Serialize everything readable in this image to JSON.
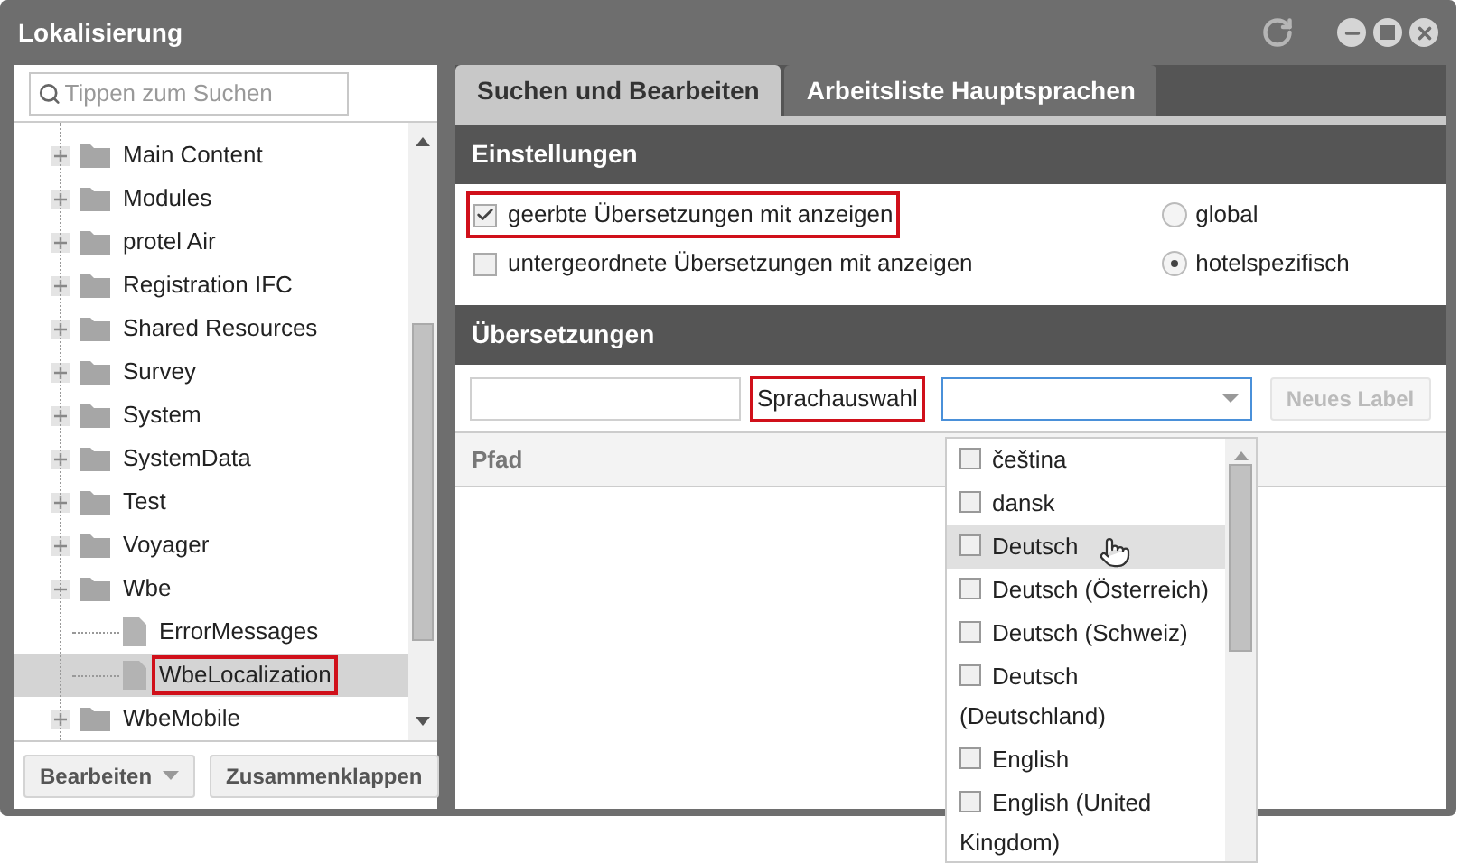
{
  "window": {
    "title": "Lokalisierung"
  },
  "sidebar": {
    "search": {
      "placeholder": "Tippen zum Suchen"
    },
    "tree": [
      {
        "label": "Main Content",
        "kind": "folder",
        "expanded": false
      },
      {
        "label": "Modules",
        "kind": "folder",
        "expanded": false
      },
      {
        "label": "protel Air",
        "kind": "folder",
        "expanded": false
      },
      {
        "label": "Registration IFC",
        "kind": "folder",
        "expanded": false
      },
      {
        "label": "Shared Resources",
        "kind": "folder",
        "expanded": false
      },
      {
        "label": "Survey",
        "kind": "folder",
        "expanded": false
      },
      {
        "label": "System",
        "kind": "folder",
        "expanded": false
      },
      {
        "label": "SystemData",
        "kind": "folder",
        "expanded": false
      },
      {
        "label": "Test",
        "kind": "folder",
        "expanded": false
      },
      {
        "label": "Voyager",
        "kind": "folder",
        "expanded": false
      },
      {
        "label": "Wbe",
        "kind": "folder",
        "expanded": true,
        "children": [
          {
            "label": "ErrorMessages",
            "kind": "file",
            "selected": false,
            "highlighted": false
          },
          {
            "label": "WbeLocalization",
            "kind": "file",
            "selected": true,
            "highlighted": true
          }
        ]
      },
      {
        "label": "WbeMobile",
        "kind": "folder",
        "expanded": false
      }
    ],
    "buttons": [
      {
        "label": "Bearbeiten",
        "dropdown": true
      },
      {
        "label": "Zusammenklappen",
        "dropdown": false
      }
    ]
  },
  "tabs": [
    {
      "label": "Suchen und Bearbeiten",
      "selected": true
    },
    {
      "label": "Arbeitsliste Hauptsprachen",
      "selected": false
    }
  ],
  "settings": {
    "title": "Einstellungen",
    "checkboxes": [
      {
        "label": "geerbte Übersetzungen mit anzeigen",
        "checked": true,
        "highlighted": true
      },
      {
        "label": "untergeordnete Übersetzungen mit anzeigen",
        "checked": false,
        "highlighted": false
      }
    ],
    "radios": [
      {
        "label": "global",
        "selected": false
      },
      {
        "label": "hotelspezifisch",
        "selected": true
      }
    ]
  },
  "translations": {
    "title": "Übersetzungen",
    "language_label": {
      "text": "Sprachauswahl",
      "highlighted": true
    },
    "new_label_button": {
      "label": "Neues Label",
      "disabled": true
    },
    "column": "Pfad",
    "language_options": [
      {
        "label": "čeština",
        "checked": false,
        "hovered": false
      },
      {
        "label": "dansk",
        "checked": false,
        "hovered": false
      },
      {
        "label": "Deutsch",
        "checked": false,
        "hovered": true
      },
      {
        "label": "Deutsch (Österreich)",
        "checked": false,
        "hovered": false
      },
      {
        "label": "Deutsch (Schweiz)",
        "checked": false,
        "hovered": false
      },
      {
        "label": "Deutsch (Deutschland)",
        "checked": false,
        "hovered": false
      },
      {
        "label": "English",
        "checked": false,
        "hovered": false
      },
      {
        "label": "English (United Kingdom)",
        "checked": false,
        "hovered": false
      }
    ]
  }
}
